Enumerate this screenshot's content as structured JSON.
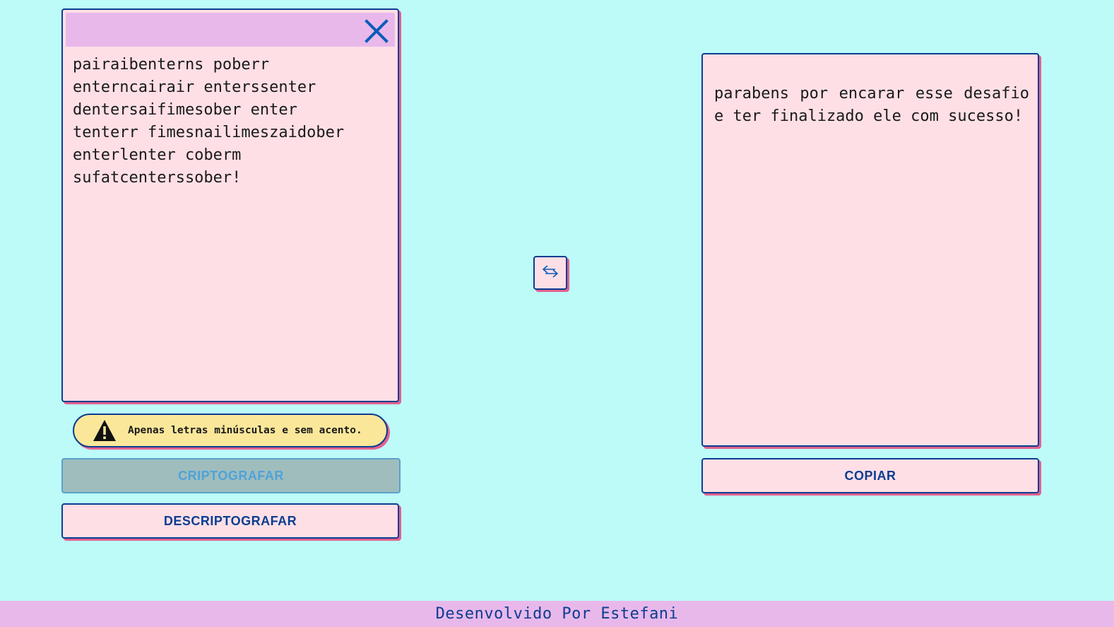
{
  "input": {
    "text": "pairaibenterns poberr\nenterncairair enterssenter\ndentersaifimesober enter\ntenterr fimesnailimeszaidober\nenterlenter coberm\nsufatcenterssober!",
    "close_icon": "close-icon"
  },
  "warning": {
    "icon": "warning-triangle-icon",
    "text": "Apenas letras minúsculas e sem acento."
  },
  "buttons": {
    "encrypt_label": "CRIPTOGRAFAR",
    "decrypt_label": "DESCRIPTOGRAFAR",
    "copy_label": "COPIAR",
    "swap_icon": "swap-arrows-icon"
  },
  "output": {
    "text": "parabens por encarar esse desafio e ter finalizado ele com sucesso!"
  },
  "footer": {
    "credit": "Desenvolvido Por Estefani"
  },
  "colors": {
    "background": "#bdfbf9",
    "card": "#ffdfe6",
    "header": "#e8b8ea",
    "border": "#0a3d91",
    "shadow": "#e2618f",
    "warning": "#fbe79a",
    "disabled_button": "#9fbdbd"
  }
}
